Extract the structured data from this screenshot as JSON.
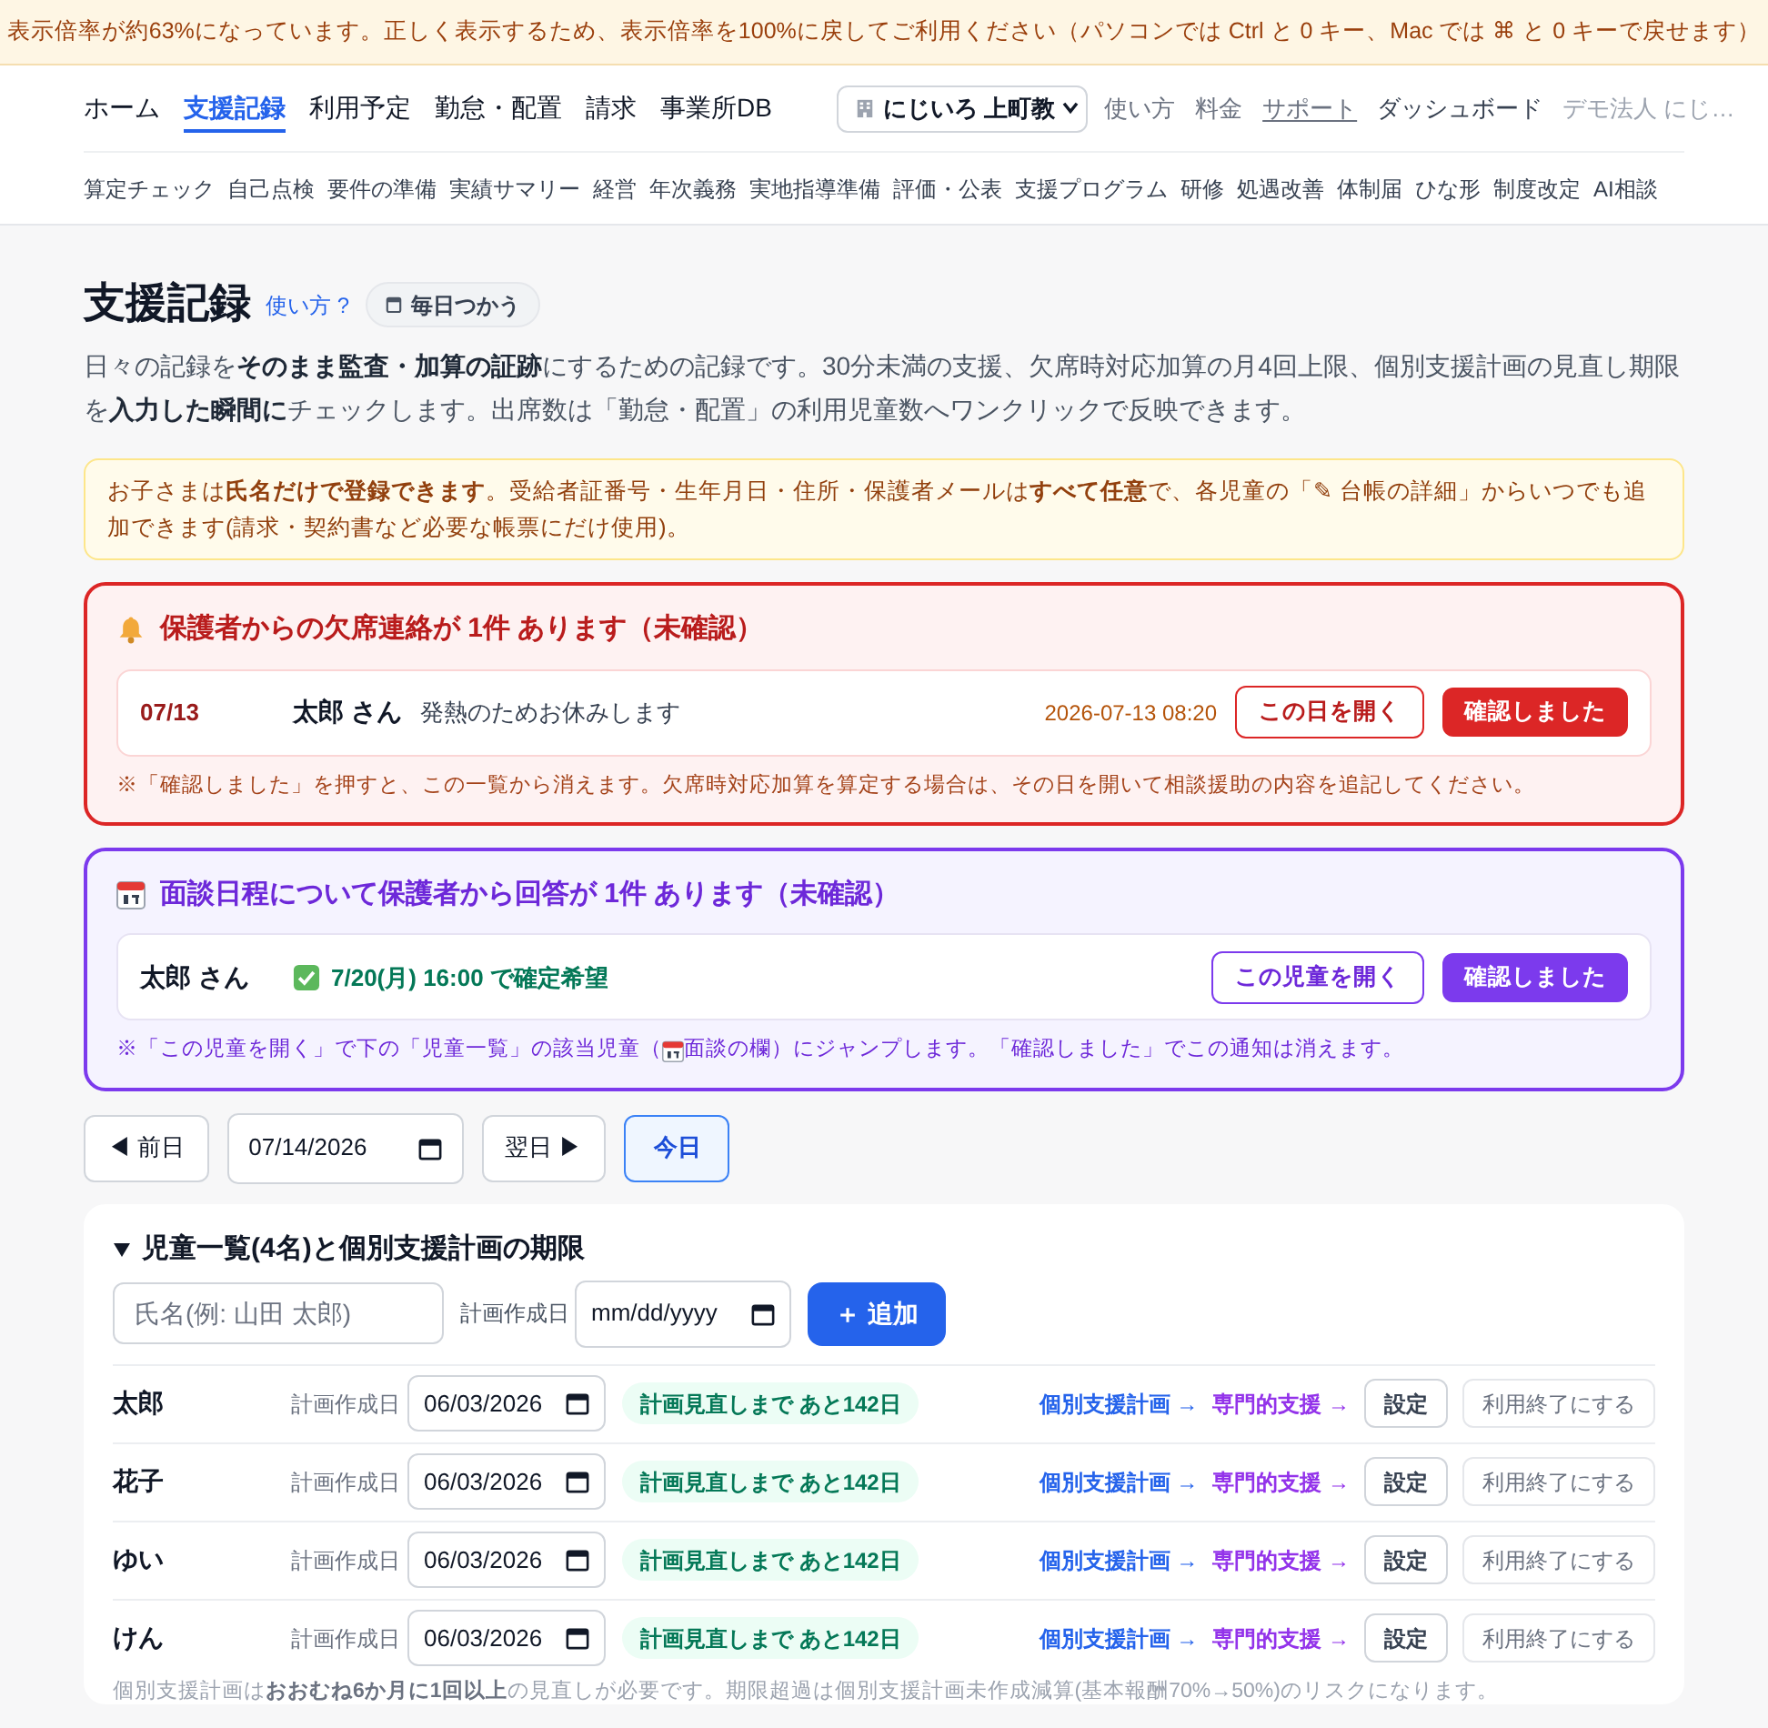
{
  "zoom_banner": {
    "text": "表示倍率が約63%になっています。正しく表示するため、表示倍率を100%に戻してご利用ください（パソコンでは Ctrl と 0 キー、Mac では ⌘ と 0 キーで戻せます）"
  },
  "nav": {
    "tabs": [
      {
        "label": "ホーム",
        "selected": false
      },
      {
        "label": "支援記録",
        "selected": true
      },
      {
        "label": "利用予定",
        "selected": false
      },
      {
        "label": "勤怠・配置",
        "selected": false
      },
      {
        "label": "請求",
        "selected": false
      },
      {
        "label": "事業所DB",
        "selected": false
      }
    ],
    "facility_select": {
      "value": "にじいろ 上町教"
    },
    "links": [
      {
        "label": "使い方",
        "kind": "plain"
      },
      {
        "label": "料金",
        "kind": "plain"
      },
      {
        "label": "サポート",
        "kind": "underlined"
      },
      {
        "label": "ダッシュボード",
        "kind": "strong"
      },
      {
        "label": "デモ法人 にじ…",
        "kind": "muted"
      }
    ],
    "sub_links": [
      "算定チェック",
      "自己点検",
      "要件の準備",
      "実績サマリー",
      "経営",
      "年次義務",
      "実地指導準備",
      "評価・公表",
      "支援プログラム",
      "研修",
      "処遇改善",
      "体制届",
      "ひな形",
      "制度改定",
      "AI相談"
    ]
  },
  "page": {
    "title": "支援記録",
    "help_link": "使い方 ?",
    "badge": "毎日つかう",
    "description": "日々の記録を**そのまま監査・加算の証跡**にするための記録です。30分未満の支援、欠席時対応加算の月4回上限、個別支援計画の見直し期限を**入力した瞬間に**チェックします。出席数は「勤怠・配置」の利用児童数へワンクリックで反映できます。"
  },
  "notice": {
    "text": "お子さまは**氏名だけで登録できます**。受給者証番号・生年月日・住所・保護者メールは**すべて任意**で、各児童の「✎ 台帳の詳細」からいつでも追加できます(請求・契約書など必要な帳票にだけ使用)。"
  },
  "absence_alert": {
    "title": "保護者からの欠席連絡が 1件 あります（未確認）",
    "items": [
      {
        "date": "07/13",
        "child": "太郎 さん",
        "message": "発熱のためお休みします",
        "received": "2026-07-13 08:20",
        "open_button": "この日を開く",
        "confirm_button": "確認しました"
      }
    ],
    "note": "※「確認しました」を押すと、この一覧から消えます。欠席時対応加算を算定する場合は、その日を開いて相談援助の内容を追記してください。"
  },
  "interview_alert": {
    "title": "面談日程について保護者から回答が 1件 あります（未確認）",
    "items": [
      {
        "child": "太郎 さん",
        "status": "7/20(月) 16:00 で確定希望",
        "open_button": "この児童を開く",
        "confirm_button": "確認しました"
      }
    ],
    "note_parts": [
      "※「この児童を開く」で下の「児童一覧」の該当児童（",
      "面談の欄）にジャンプします。「確認しました」でこの通知は消えます。"
    ]
  },
  "date_nav": {
    "prev": "◀ 前日",
    "date": "07/14/2026",
    "next": "翌日 ▶",
    "today": "今日"
  },
  "children_panel": {
    "title": "児童一覧(4名)と個別支援計画の期限",
    "expanded": true,
    "add_form": {
      "name_placeholder": "氏名(例: 山田 太郎)",
      "date_label": "計画作成日",
      "date_placeholder": "mm/dd/yyyy",
      "add_button": "＋ 追加"
    },
    "rows": [
      {
        "name": "太郎",
        "date_label": "計画作成日",
        "date": "06/03/2026",
        "deadline": "計画見直しまで あと142日",
        "plan_link": "個別支援計画 →",
        "support_link": "専門的支援 →",
        "settings_button": "設定",
        "end_button": "利用終了にする"
      },
      {
        "name": "花子",
        "date_label": "計画作成日",
        "date": "06/03/2026",
        "deadline": "計画見直しまで あと142日",
        "plan_link": "個別支援計画 →",
        "support_link": "専門的支援 →",
        "settings_button": "設定",
        "end_button": "利用終了にする"
      },
      {
        "name": "ゆい",
        "date_label": "計画作成日",
        "date": "06/03/2026",
        "deadline": "計画見直しまで あと142日",
        "plan_link": "個別支援計画 →",
        "support_link": "専門的支援 →",
        "settings_button": "設定",
        "end_button": "利用終了にする"
      },
      {
        "name": "けん",
        "date_label": "計画作成日",
        "date": "06/03/2026",
        "deadline": "計画見直しまで あと142日",
        "plan_link": "個別支援計画 →",
        "support_link": "専門的支援 →",
        "settings_button": "設定",
        "end_button": "利用終了にする"
      }
    ],
    "footnote": "個別支援計画は**おおむね6か月に1回以上**の見直しが必要です。期限超過は個別支援計画未作成減算(基本報酬70%→50%)のリスクになります。"
  }
}
